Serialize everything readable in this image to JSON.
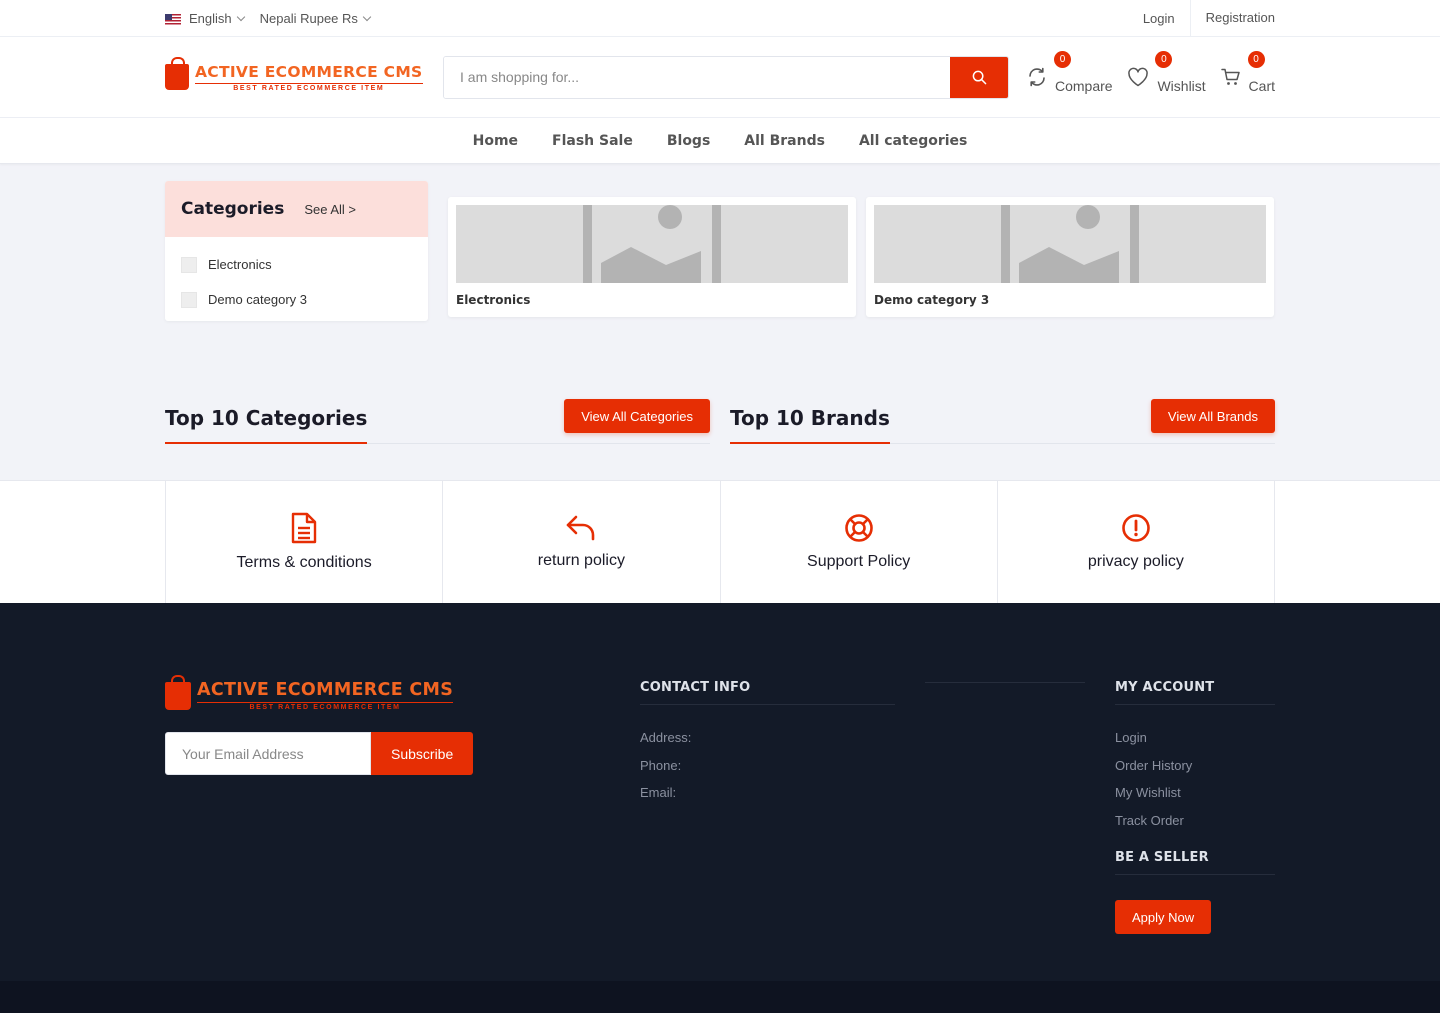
{
  "topbar": {
    "language": "English",
    "currency": "Nepali Rupee Rs",
    "login": "Login",
    "registration": "Registration"
  },
  "header": {
    "logo_title": "ACTIVE ECOMMERCE CMS",
    "logo_sub": "BEST RATED ECOMMERCE ITEM",
    "search_placeholder": "I am shopping for...",
    "compare_label": "Compare",
    "compare_count": "0",
    "wishlist_label": "Wishlist",
    "wishlist_count": "0",
    "cart_label": "Cart",
    "cart_count": "0"
  },
  "nav": {
    "items": [
      "Home",
      "Flash Sale",
      "Blogs",
      "All Brands",
      "All categories"
    ]
  },
  "categories": {
    "title": "Categories",
    "see_all": "See All >",
    "items": [
      "Electronics",
      "Demo category 3"
    ]
  },
  "featured_cards": [
    "Electronics",
    "Demo category 3"
  ],
  "top10": {
    "categories_title": "Top 10 Categories",
    "categories_button": "View All Categories",
    "brands_title": "Top 10 Brands",
    "brands_button": "View All Brands"
  },
  "policies": [
    "Terms & conditions",
    "return policy",
    "Support Policy",
    "privacy policy"
  ],
  "footer": {
    "email_placeholder": "Your Email Address",
    "subscribe": "Subscribe",
    "contact_title": "CONTACT INFO",
    "contact_items": [
      "Address:",
      "Phone:",
      "Email:"
    ],
    "account_title": "MY ACCOUNT",
    "account_items": [
      "Login",
      "Order History",
      "My Wishlist",
      "Track Order"
    ],
    "seller_title": "BE A SELLER",
    "apply_now": "Apply Now"
  },
  "colors": {
    "accent": "#e62e04",
    "footer_bg": "#131a28",
    "category_head_bg": "#fcdfdb"
  }
}
